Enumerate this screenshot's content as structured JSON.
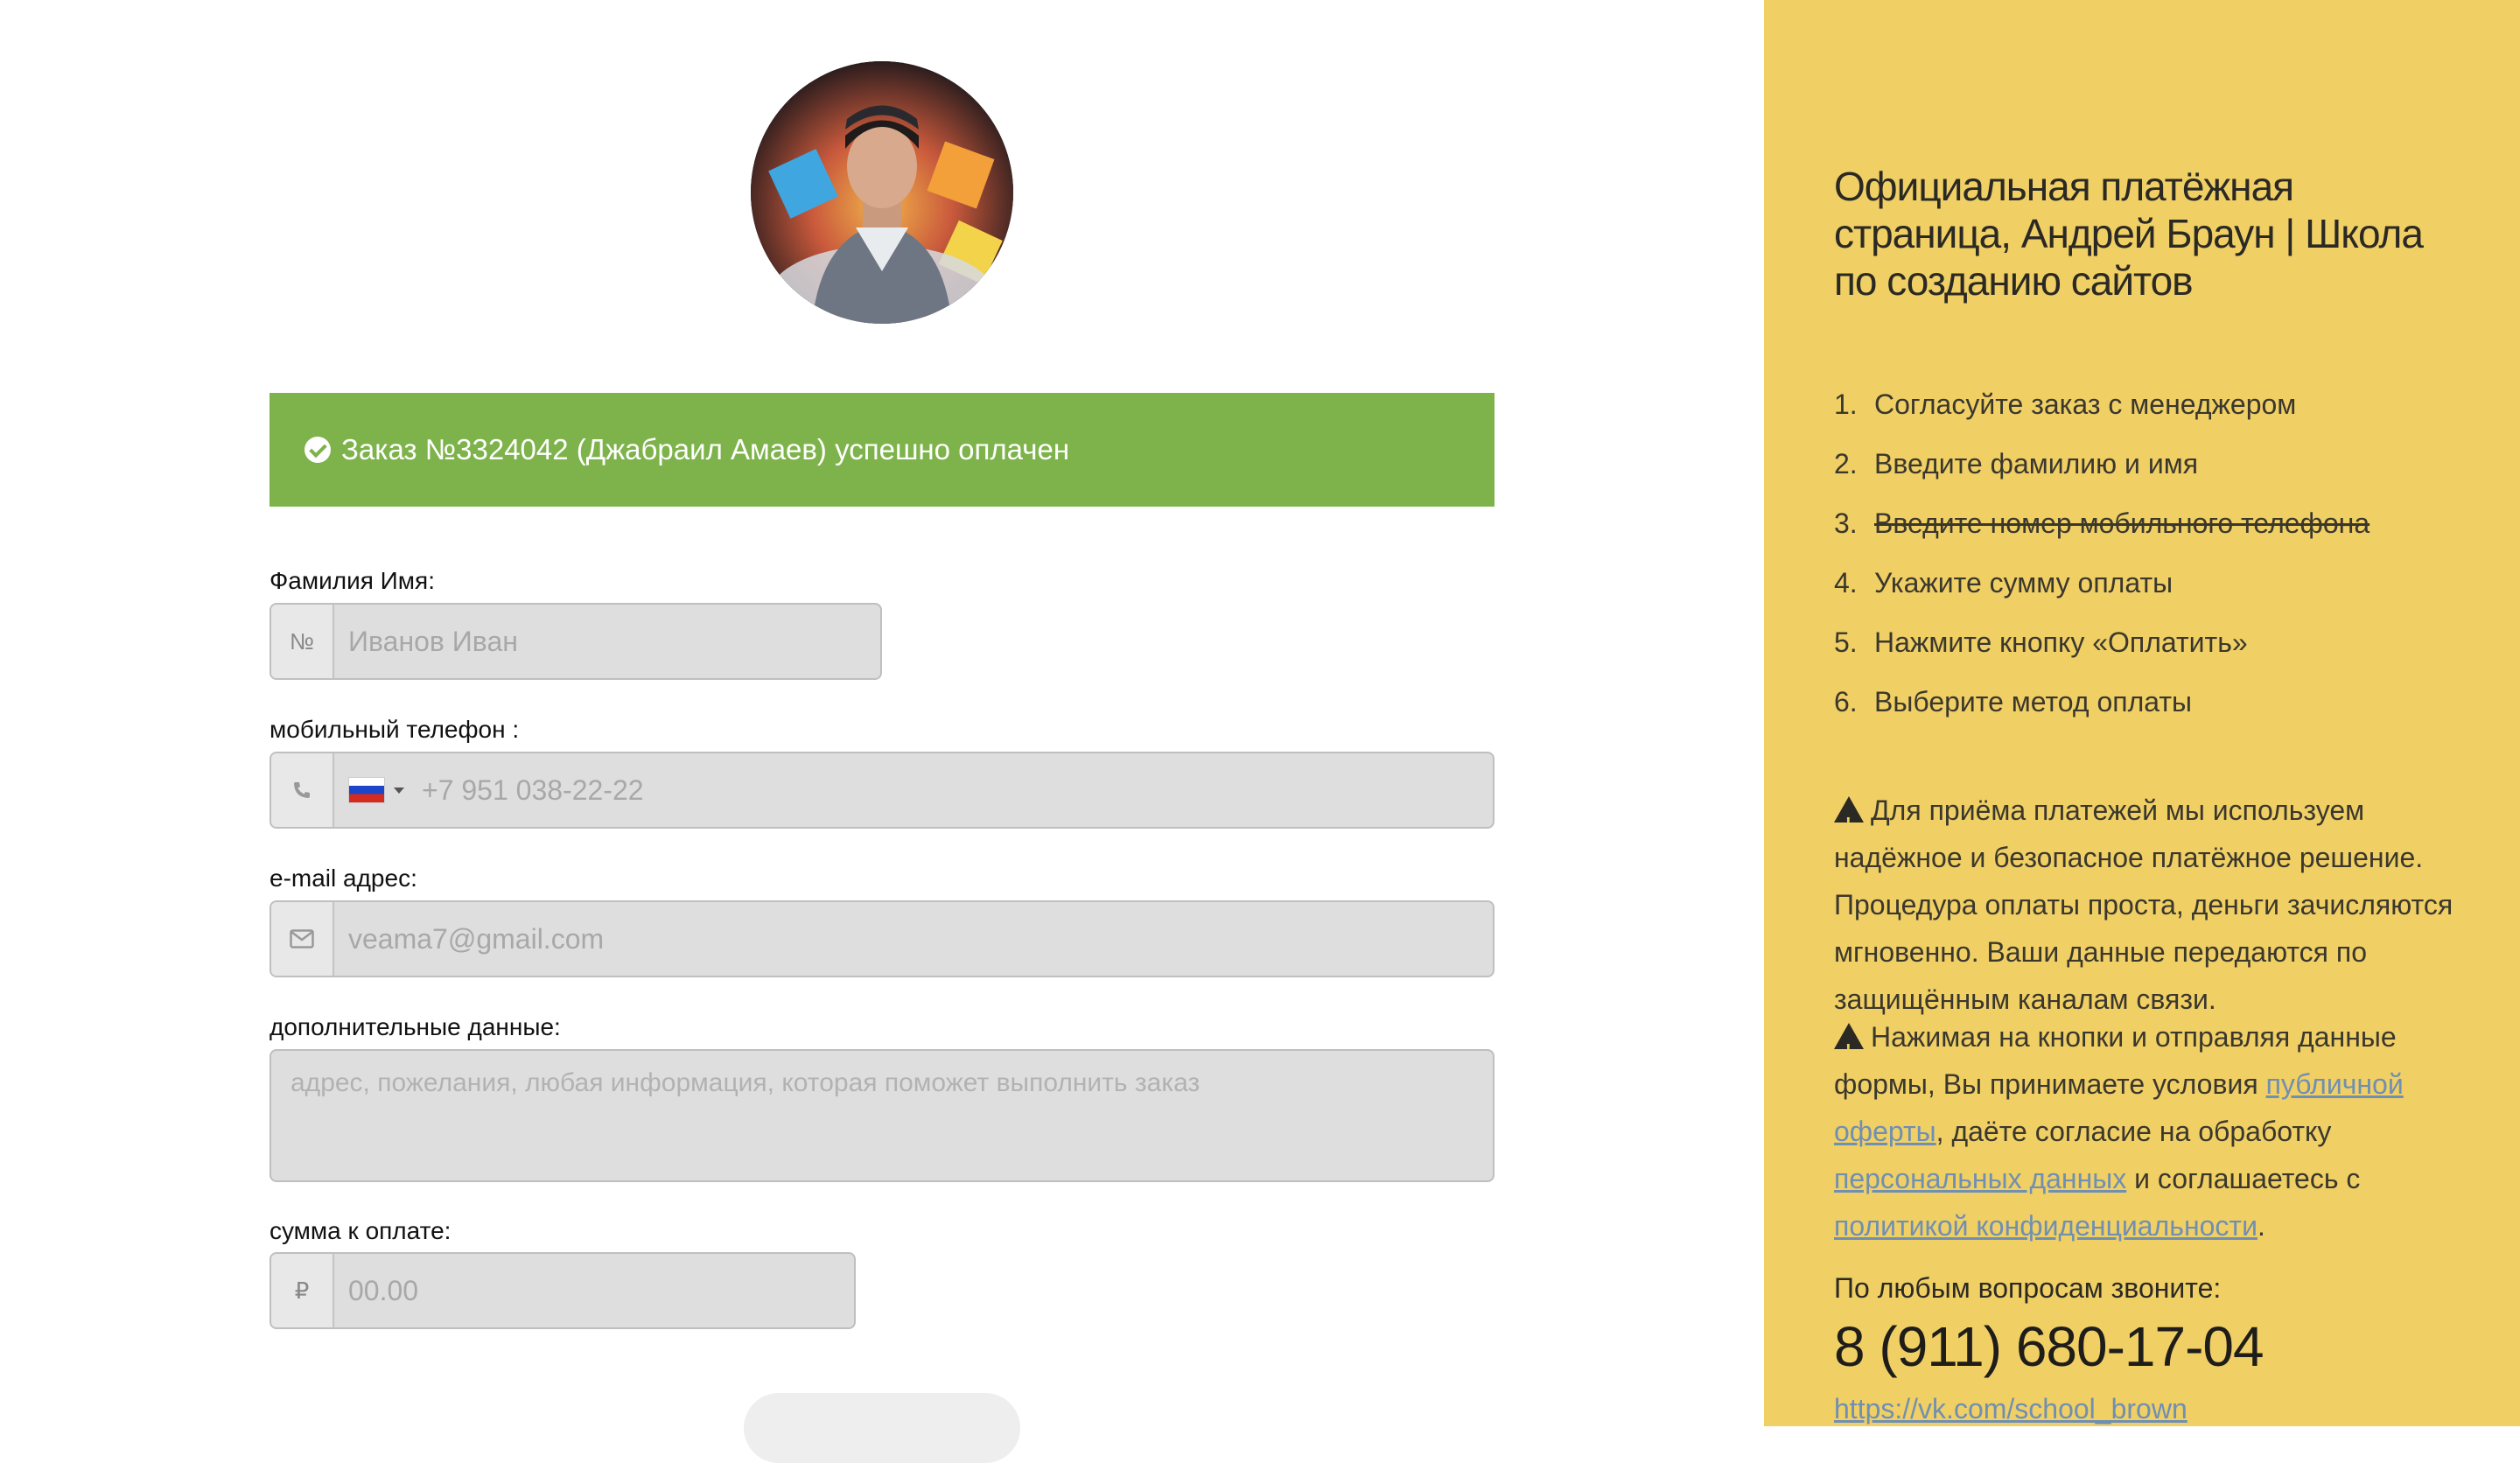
{
  "success": {
    "message": "Заказ №3324042 (Джабраил Амаев) успешно оплачен"
  },
  "form": {
    "name": {
      "label": "Фамилия Имя:",
      "addon": "№",
      "placeholder": "Иванов Иван"
    },
    "phone": {
      "label": "мобильный телефон :",
      "value": "+7 951 038-22-22"
    },
    "email": {
      "label": "e-mail адрес:",
      "value": "veama7@gmail.com"
    },
    "extra": {
      "label": "дополнительные данные:",
      "placeholder": "адрес, пожелания, любая информация, которая поможет выполнить заказ"
    },
    "amount": {
      "label": "сумма к оплате:",
      "addon": "₽",
      "placeholder": "00.00"
    }
  },
  "panel": {
    "title": "Официальная платёжная страница, Андрей Браун | Школа по созданию сайтов",
    "steps": [
      {
        "num": "1.",
        "text": "Согласуйте заказ с менеджером",
        "struck": false
      },
      {
        "num": "2.",
        "text": "Введите фамилию и имя",
        "struck": false
      },
      {
        "num": "3.",
        "text": "Введите номер мобильного телефона",
        "struck": true
      },
      {
        "num": "4.",
        "text": "Укажите сумму оплаты",
        "struck": false
      },
      {
        "num": "5.",
        "text": "Нажмите кнопку «Оплатить»",
        "struck": false
      },
      {
        "num": "6.",
        "text": "Выберите метод оплаты",
        "struck": false
      }
    ],
    "notice1": "Для приёма платежей мы используем надёжное и безопасное платёжное решение. Процедура оплаты проста, деньги зачисляются мгновенно. Ваши данные передаются по защищённым каналам связи.",
    "notice2": {
      "part1": "Нажимая на кнопки и отправляя данные формы, Вы принимаете условия",
      "link1": "публичной оферты",
      "part2": ",  даёте согласие на обработку",
      "link2": "персональных данных",
      "part3": "и соглашаетесь с",
      "link3": "политикой конфиденциальности",
      "part4": "."
    },
    "contact_label": "По любым вопросам звоните:",
    "phone": "8 (911) 680-17-04",
    "vk": "https://vk.com/school_brown"
  },
  "colors": {
    "success_bg": "#7db34a",
    "panel_bg": "#f0cf65",
    "link": "#6f8fb3"
  }
}
